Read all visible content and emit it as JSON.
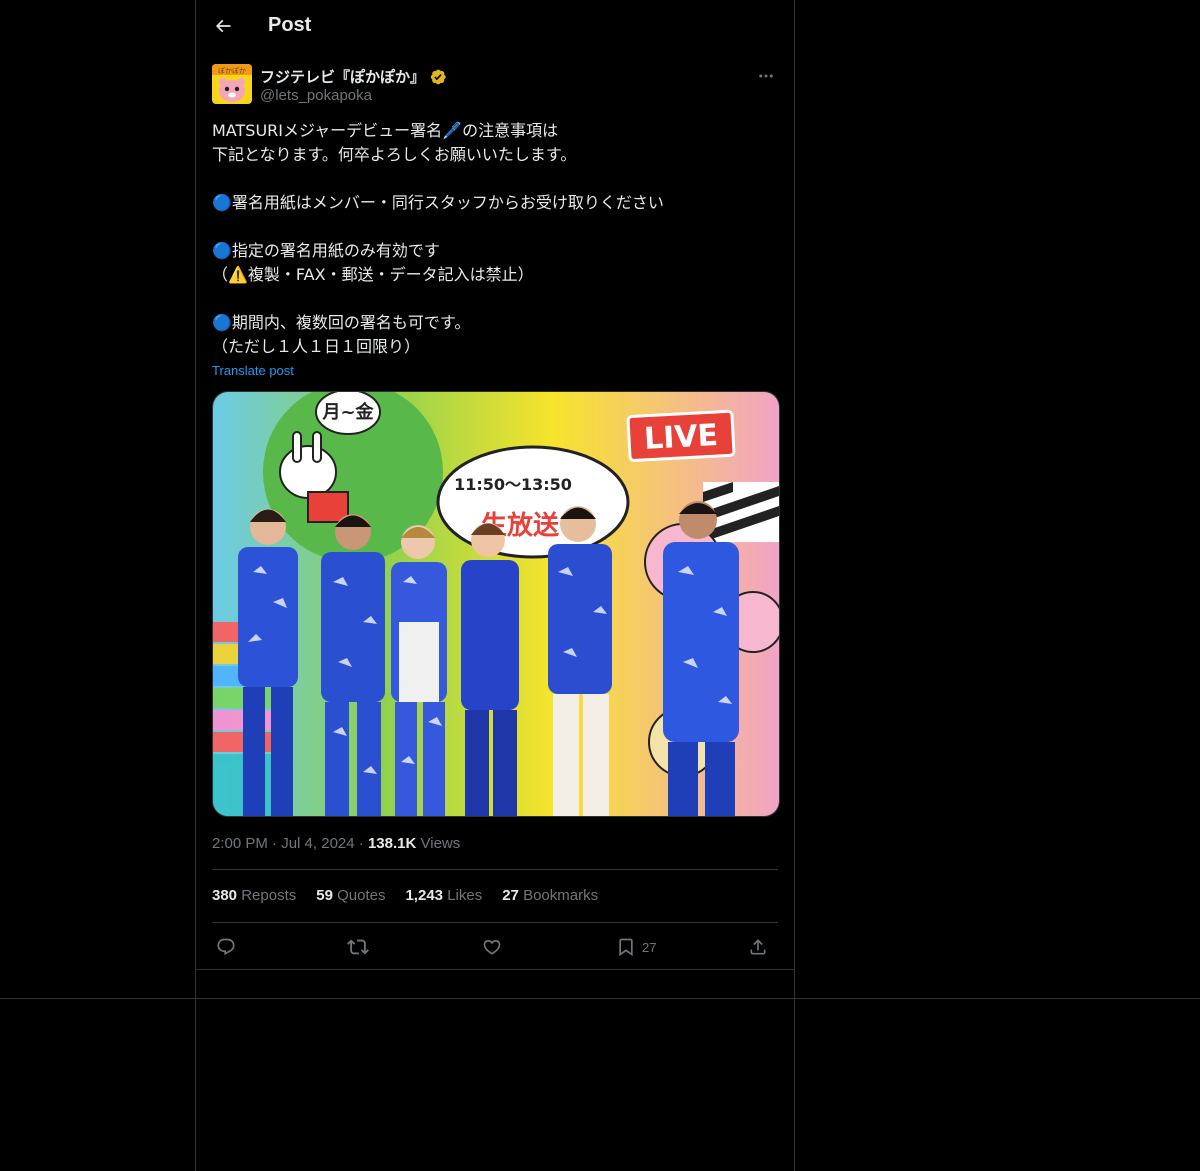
{
  "header": {
    "title": "Post",
    "back_icon": "arrow-left-icon"
  },
  "author": {
    "display_name": "フジテレビ『ぽかぽか』",
    "handle": "@lets_pokapoka",
    "verified_color": "#e2b719",
    "avatar_text": "ぽかぽか"
  },
  "tweet": {
    "text": "MATSURIメジャーデビュー署名🖊️の注意事項は\n下記となります。何卒よろしくお願いいたします。\n\n🔵署名用紙はメンバー・同行スタッフからお受け取りください\n\n🔵指定の署名用紙のみ有効です\n（⚠️複製・FAX・郵送・データ記入は禁止）\n\n🔵期間内、複数回の署名も可です。\n（ただし１人１日１回限り）",
    "translate_label": "Translate post"
  },
  "media": {
    "live_label": "LIVE",
    "days_label": "月~金",
    "time_label": "11:50～13:50",
    "banner_text": "生放送中"
  },
  "meta": {
    "time": "2:00 PM",
    "date": "Jul 4, 2024",
    "views_count": "138.1K",
    "views_label": "Views"
  },
  "stats": {
    "reposts_count": "380",
    "reposts_label": "Reposts",
    "quotes_count": "59",
    "quotes_label": "Quotes",
    "likes_count": "1,243",
    "likes_label": "Likes",
    "bookmarks_count": "27",
    "bookmarks_label": "Bookmarks"
  },
  "actions": {
    "bookmark_count": "27"
  },
  "colors": {
    "background": "#000000",
    "text": "#e7e9ea",
    "muted": "#71767b",
    "accent": "#1d9bf0",
    "border": "#2f3336"
  }
}
